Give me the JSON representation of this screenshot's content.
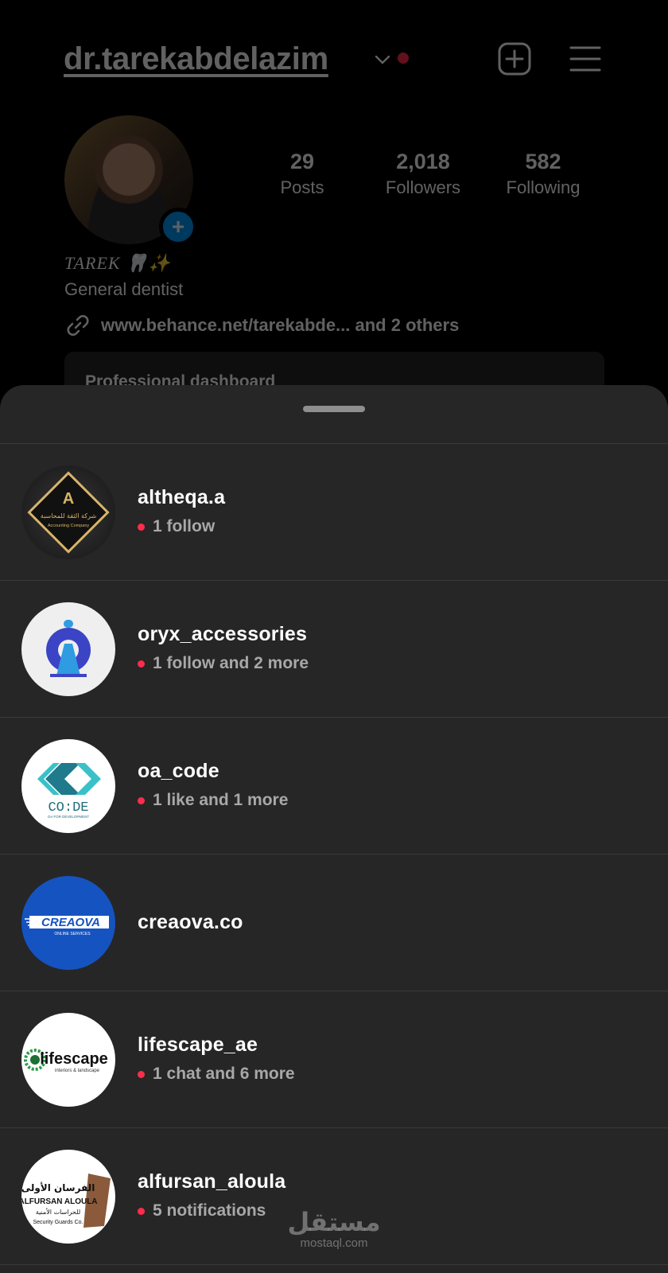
{
  "profile": {
    "username": "dr.tarekabdelazim",
    "stats": [
      {
        "value": "29",
        "label": "Posts"
      },
      {
        "value": "2,018",
        "label": "Followers"
      },
      {
        "value": "582",
        "label": "Following"
      }
    ],
    "display_name": "TAREK 🦷✨",
    "bio": "General dentist",
    "link_text": "www.behance.net/tarekabde...  and 2 others",
    "dashboard_label": "Professional dashboard"
  },
  "accounts": [
    {
      "username": "altheqa.a",
      "activity": "1 follow"
    },
    {
      "username": "oryx_accessories",
      "activity": "1 follow and 2 more"
    },
    {
      "username": "oa_code",
      "activity": "1 like and 1 more"
    },
    {
      "username": "creaova.co",
      "activity": ""
    },
    {
      "username": "lifescape_ae",
      "activity": "1 chat and 6 more"
    },
    {
      "username": "alfursan_aloula",
      "activity": "5 notifications"
    }
  ],
  "avatar_text": {
    "altheqa": "شركة الثقة للمحاسبة",
    "altheqa_sub": "Accounting Company",
    "oacode": "CO:DE",
    "oacode_sub": "OA FOR DEVELOPMENT",
    "creaova": "CREAOVA",
    "creaova_sub": "ONLINE SERVICES",
    "lifescape": "lifescape",
    "lifescape_sub": "interiors & landscape",
    "alfursan_ar": "الفرسان الأولى",
    "alfursan_en": "ALFURSAN ALOULA",
    "alfursan_ar2": "للحراسات الأمنية",
    "alfursan_sub": "Security Guards Co."
  },
  "watermark": {
    "arabic": "مستقل",
    "latin": "mostaql.com"
  },
  "colors": {
    "accent_blue": "#0095f6",
    "notification_red": "#ff2d4b",
    "sheet_bg": "#262626"
  }
}
